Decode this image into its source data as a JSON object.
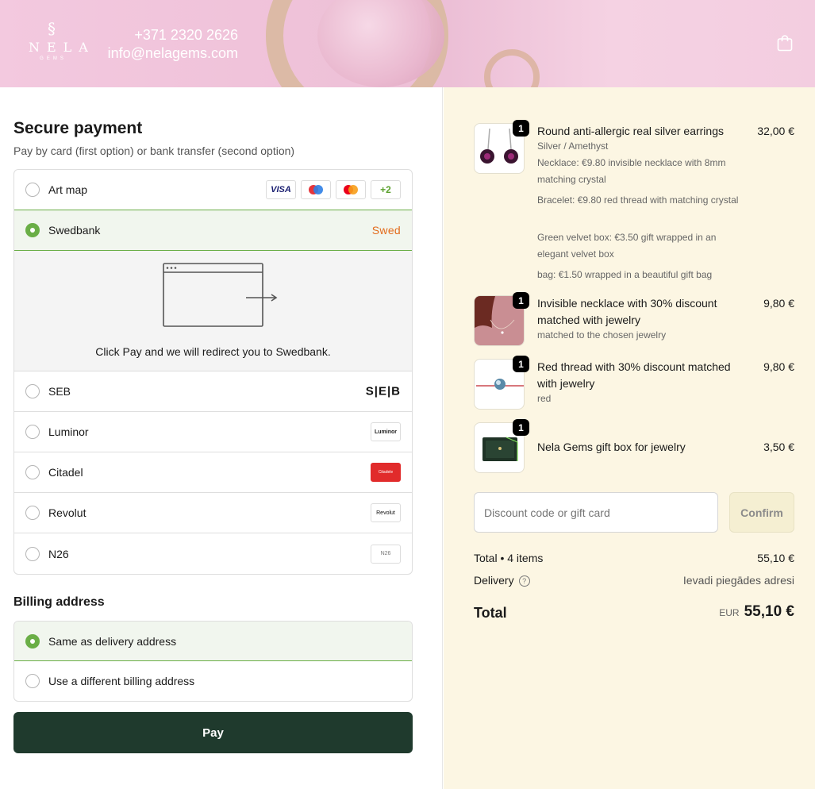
{
  "header": {
    "logo": {
      "mark": "§",
      "name": "NELA",
      "sub": "GEMS"
    },
    "phone": "+371 2320 2626",
    "email": "info@nelagems.com"
  },
  "payment": {
    "title": "Secure payment",
    "subtitle": "Pay by card (first option) or bank transfer (second option)",
    "options": [
      {
        "label": "Art map",
        "selected": false,
        "badges": [
          "VISA",
          "maestro",
          "mastercard",
          "+2"
        ]
      },
      {
        "label": "Swedbank",
        "selected": true,
        "badge": "Swed"
      },
      {
        "label": "SEB",
        "selected": false,
        "badge": "S|E|B"
      },
      {
        "label": "Luminor",
        "selected": false,
        "badge": "Luminor"
      },
      {
        "label": "Citadel",
        "selected": false,
        "badge": "Citadele"
      },
      {
        "label": "Revolut",
        "selected": false,
        "badge": "Revolut"
      },
      {
        "label": "N26",
        "selected": false,
        "badge": "N26"
      }
    ],
    "redirect_text": "Click Pay and we will redirect you to Swedbank."
  },
  "billing": {
    "title": "Billing address",
    "options": [
      {
        "label": "Same as delivery address",
        "selected": true
      },
      {
        "label": "Use a different billing address",
        "selected": false
      }
    ]
  },
  "pay_button": "Pay",
  "order": {
    "items": [
      {
        "qty": "1",
        "title": "Round anti-allergic real silver earrings",
        "price": "32,00 €",
        "variant": "Silver / Amethyst",
        "addons": [
          "Necklace: €9.80 invisible necklace with 8mm matching crystal",
          "Bracelet: €9.80 red thread with matching crystal",
          "Green velvet box: €3.50 gift wrapped in an elegant velvet box",
          "bag: €1.50 wrapped in a beautiful gift bag"
        ]
      },
      {
        "qty": "1",
        "title": "Invisible necklace with 30% discount matched with jewelry",
        "price": "9,80 €",
        "variant": "matched to the chosen jewelry"
      },
      {
        "qty": "1",
        "title": "Red thread with 30% discount matched with jewelry",
        "price": "9,80 €",
        "variant": "red"
      },
      {
        "qty": "1",
        "title": "Nela Gems gift box for jewelry",
        "price": "3,50 €"
      }
    ],
    "discount_placeholder": "Discount code or gift card",
    "confirm_label": "Confirm",
    "subtotal_label": "Total • 4 items",
    "subtotal_value": "55,10 €",
    "delivery_label": "Delivery",
    "delivery_value": "Ievadi piegādes adresi",
    "total_label": "Total",
    "total_currency": "EUR",
    "total_value": "55,10 €"
  },
  "colors": {
    "accent_green": "#6aae46",
    "pay_button_bg": "#1f3a2d",
    "summary_bg": "#fcf6e3",
    "header_pink": "#f0c3da"
  }
}
